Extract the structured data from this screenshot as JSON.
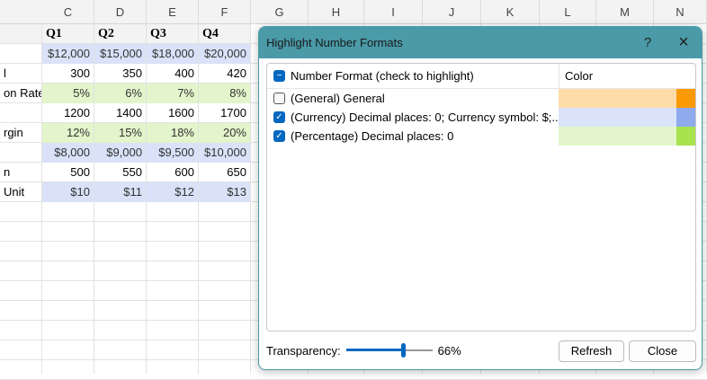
{
  "columns": [
    "C",
    "D",
    "E",
    "F",
    "G",
    "H",
    "I",
    "J",
    "K",
    "L",
    "M",
    "N"
  ],
  "sheet": {
    "header": [
      "Q1",
      "Q2",
      "Q3",
      "Q4"
    ],
    "rows": [
      {
        "label": "",
        "values": [
          "$12,000",
          "$15,000",
          "$18,000",
          "$20,000"
        ],
        "fmt": "cur"
      },
      {
        "label": "l",
        "values": [
          "300",
          "350",
          "400",
          "420"
        ],
        "fmt": ""
      },
      {
        "label": "on Rate",
        "values": [
          "5%",
          "6%",
          "7%",
          "8%"
        ],
        "fmt": "pct"
      },
      {
        "label": "",
        "values": [
          "1200",
          "1400",
          "1600",
          "1700"
        ],
        "fmt": ""
      },
      {
        "label": "rgin",
        "values": [
          "12%",
          "15%",
          "18%",
          "20%"
        ],
        "fmt": "pct"
      },
      {
        "label": "",
        "values": [
          "$8,000",
          "$9,000",
          "$9,500",
          "$10,000"
        ],
        "fmt": "cur"
      },
      {
        "label": "n",
        "values": [
          "500",
          "550",
          "600",
          "650"
        ],
        "fmt": ""
      },
      {
        "label": "Unit",
        "values": [
          "$10",
          "$11",
          "$12",
          "$13"
        ],
        "fmt": "cur"
      }
    ]
  },
  "dialog": {
    "title": "Highlight Number Formats",
    "help": "?",
    "close_icon": "×",
    "header_format": "Number Format (check to highlight)",
    "header_color": "Color",
    "items": [
      {
        "label": "(General) General",
        "checked": false,
        "light": "#fddcaa",
        "accent": "#fb9a06"
      },
      {
        "label": "(Currency) Decimal places: 0; Currency symbol: $;...",
        "checked": true,
        "light": "#dae3f9",
        "accent": "#8fabed"
      },
      {
        "label": "(Percentage) Decimal places: 0",
        "checked": true,
        "light": "#e2f5cb",
        "accent": "#a8e34e"
      }
    ],
    "transparency_label": "Transparency:",
    "transparency_value": 66,
    "transparency_text": "66%",
    "refresh": "Refresh",
    "close": "Close"
  }
}
